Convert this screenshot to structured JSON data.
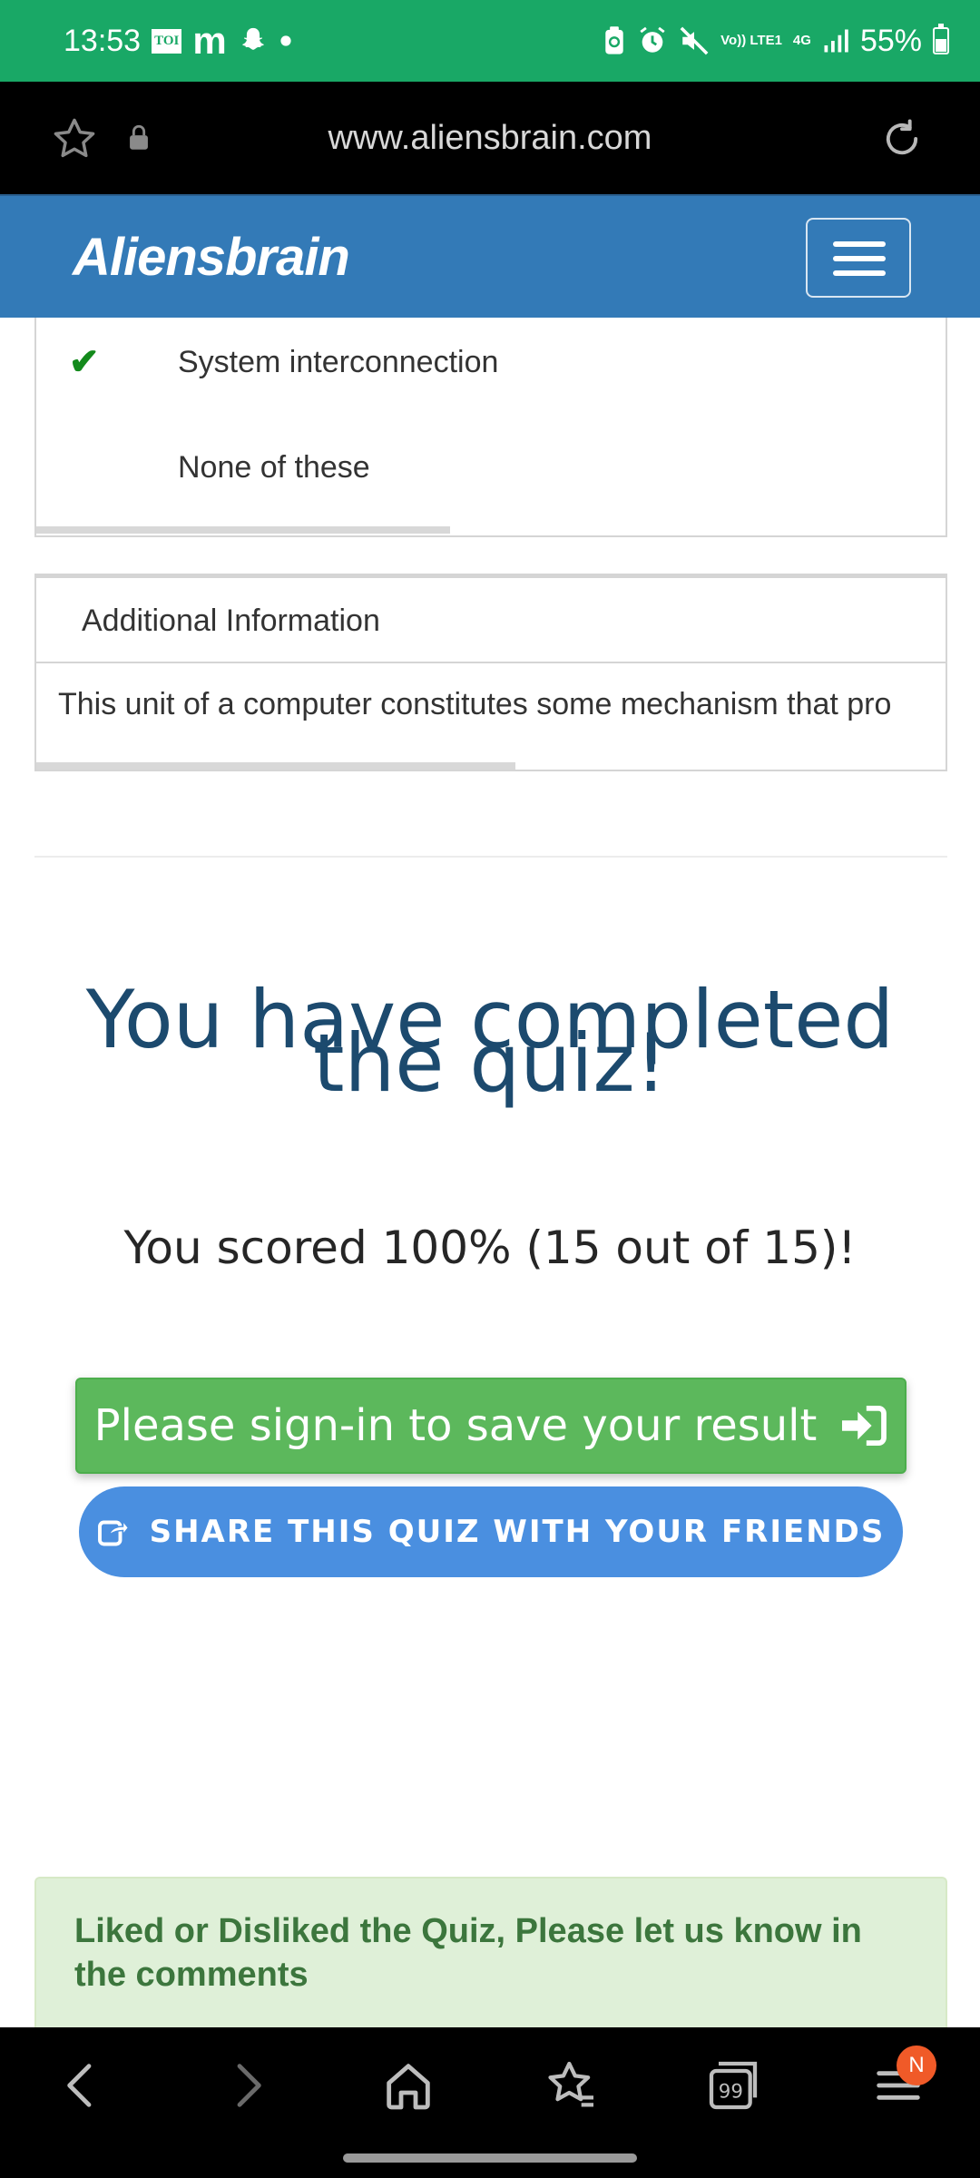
{
  "status_bar": {
    "time": "13:53",
    "app_badge": "TOI",
    "network_label": "Vo)) LTE1",
    "network_type": "4G",
    "battery": "55%",
    "icons": [
      "toi-icon",
      "m-icon",
      "snapchat-icon",
      "dot-icon",
      "battery-saver-icon",
      "alarm-icon",
      "mute-icon",
      "signal-icon",
      "battery-icon"
    ]
  },
  "browser": {
    "url": "www.aliensbrain.com",
    "icons": [
      "star-icon",
      "lock-icon",
      "reload-icon"
    ]
  },
  "navbar": {
    "brand": "Aliensbrain",
    "menu_icon": "hamburger-icon",
    "color": "#337ab7"
  },
  "options": [
    {
      "label": "System interconnection",
      "correct": true
    },
    {
      "label": "None of these",
      "correct": false
    }
  ],
  "additional_info": {
    "title": "Additional Information",
    "body": "This unit of a computer constitutes some mechanism that pro"
  },
  "result": {
    "heading": "You have completed the quiz!",
    "score_text": "You scored 100% (15 out of 15)!"
  },
  "buttons": {
    "signin_label": "Please sign-in to save your result",
    "share_label": "SHARE THIS QUIZ WITH YOUR FRIENDS"
  },
  "comments_notice": "Liked or Disliked the Quiz, Please let us know in the comments",
  "bottom_nav": {
    "icons": [
      "back-icon",
      "forward-icon",
      "home-icon",
      "bookmarks-icon",
      "tabs-icon",
      "menu-icon"
    ],
    "tabs_count": "99",
    "menu_badge": "N"
  },
  "colors": {
    "status_bar": "#19a866",
    "success": "#5cb85c",
    "share": "#4a8fe0",
    "heading": "#1c4a6e",
    "correct_check": "#138a1c"
  }
}
